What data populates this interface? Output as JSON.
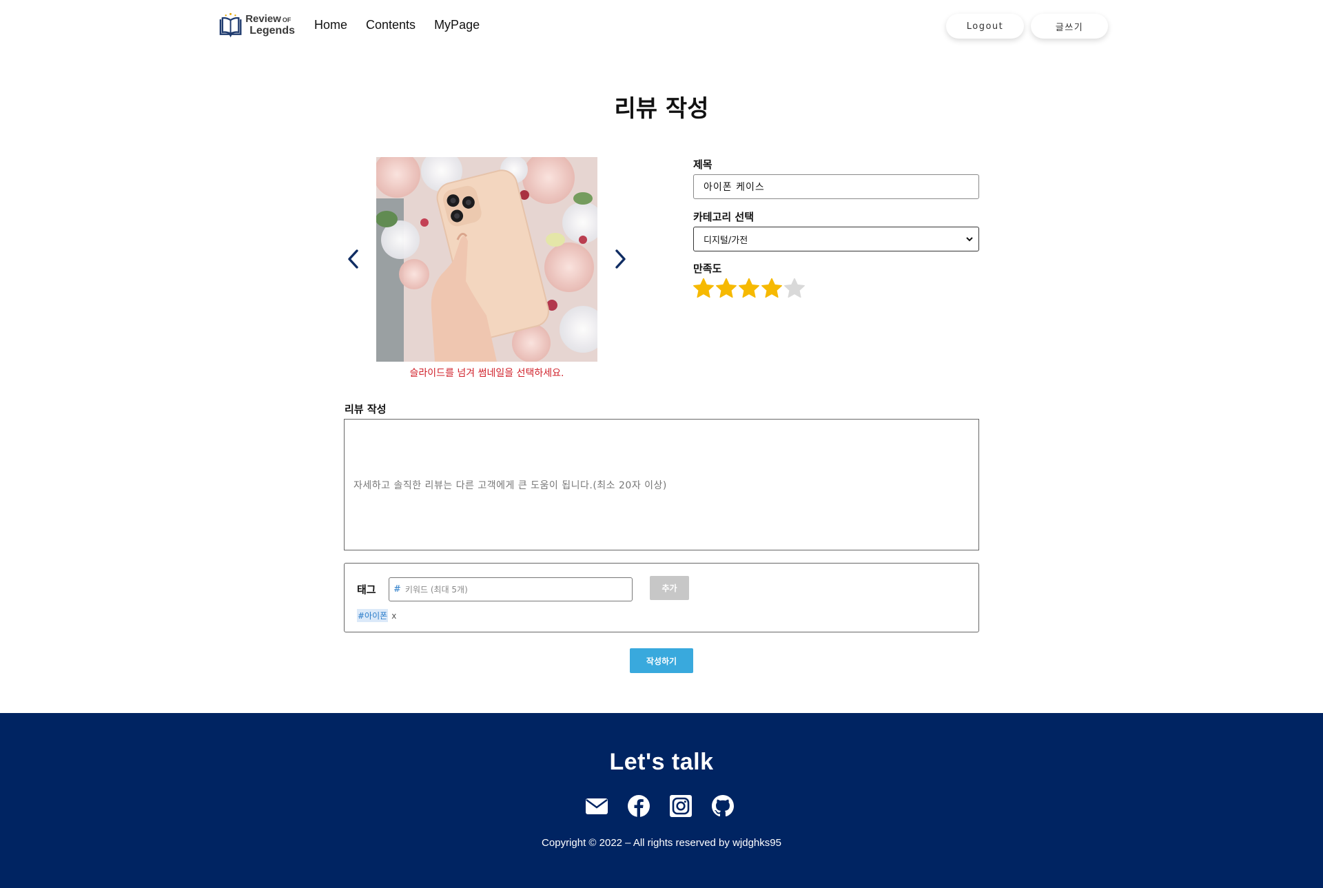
{
  "header": {
    "logo": {
      "line1": "Review",
      "of": "OF",
      "line2": "Legends"
    },
    "nav": [
      {
        "label": "Home"
      },
      {
        "label": "Contents"
      },
      {
        "label": "MyPage"
      }
    ],
    "logout_label": "Logout",
    "write_label": "글쓰기"
  },
  "page_title": "리뷰 작성",
  "slider": {
    "hint": "슬라이드를 넘겨 썸네일을 선택하세요.",
    "prev_icon": "chevron-left-icon",
    "next_icon": "chevron-right-icon"
  },
  "form": {
    "title_label": "제목",
    "title_value": "아이폰 케이스",
    "category_label": "카테고리 선택",
    "category_value": "디지털/가전",
    "rating_label": "만족도",
    "rating": {
      "value": 4,
      "max": 5
    },
    "colors": {
      "star_filled": "#f6b902",
      "star_empty": "#d9d9d9"
    }
  },
  "review": {
    "label": "리뷰 작성",
    "placeholder": "자세하고 솔직한 리뷰는 다른 고객에게 큰 도움이 됩니다.(최소 20자 이상)"
  },
  "tags": {
    "label": "태그",
    "hash": "#",
    "input_placeholder": "키워드 (최대 5개)",
    "add_label": "추가",
    "items": [
      {
        "text": "#아이폰",
        "remove": "x"
      }
    ]
  },
  "submit_label": "작성하기",
  "footer": {
    "title": "Let's talk",
    "icons": [
      "mail-icon",
      "facebook-icon",
      "instagram-icon",
      "github-icon"
    ],
    "copyright": "Copyright © 2022 – All rights reserved by wjdghks95",
    "background": "#002462"
  },
  "colors": {
    "accent": "#39a9dd",
    "hint_red": "#d0202a",
    "brand_navy": "#002462"
  }
}
